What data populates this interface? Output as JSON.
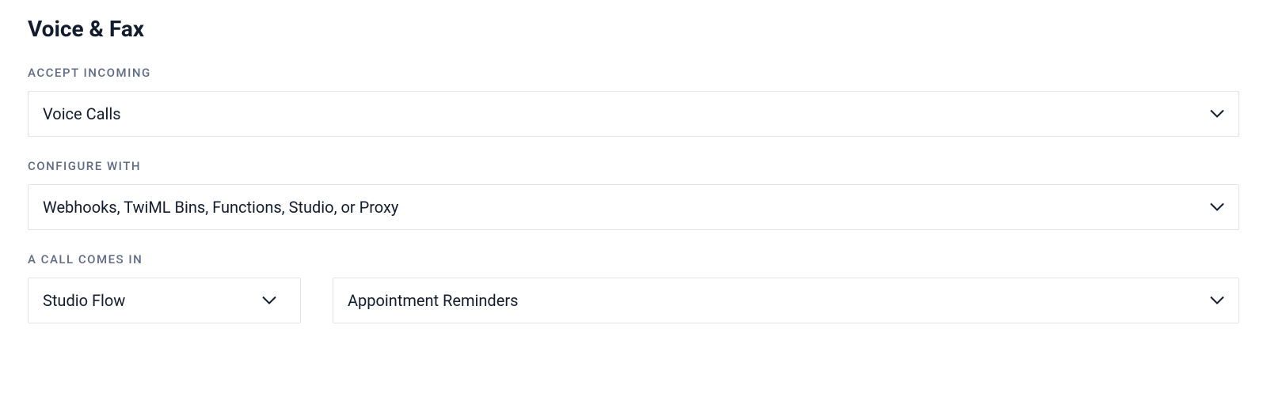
{
  "section": {
    "title": "Voice & Fax"
  },
  "fields": {
    "accept_incoming": {
      "label": "Accept Incoming",
      "value": "Voice Calls"
    },
    "configure_with": {
      "label": "Configure With",
      "value": "Webhooks, TwiML Bins, Functions, Studio, or Proxy"
    },
    "a_call_comes_in": {
      "label": "A Call Comes In",
      "handler_type": "Studio Flow",
      "handler_value": "Appointment Reminders"
    }
  }
}
